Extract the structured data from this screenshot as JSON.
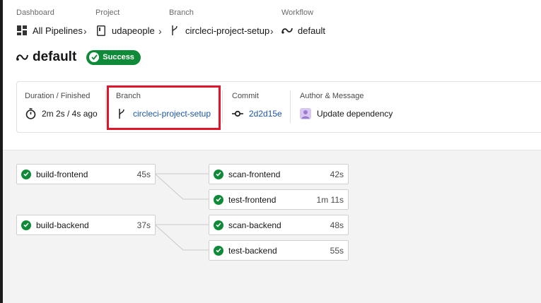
{
  "breadcrumbs": [
    {
      "label": "Dashboard",
      "value": "All Pipelines",
      "icon": "dashboard-icon"
    },
    {
      "label": "Project",
      "value": "udapeople",
      "icon": "project-icon"
    },
    {
      "label": "Branch",
      "value": "circleci-project-setup",
      "icon": "branch-icon"
    },
    {
      "label": "Workflow",
      "value": "default",
      "icon": "workflow-icon"
    }
  ],
  "title": "default",
  "status": {
    "label": "Success",
    "color": "#0f8a38"
  },
  "summary": {
    "duration": {
      "label": "Duration / Finished",
      "value": "2m 2s / 4s ago",
      "icon": "stopwatch-icon"
    },
    "branch": {
      "label": "Branch",
      "value": "circleci-project-setup",
      "icon": "branch-icon"
    },
    "commit": {
      "label": "Commit",
      "value": "2d2d15e",
      "icon": "commit-icon"
    },
    "author": {
      "label": "Author & Message",
      "value": "Update dependency",
      "icon": "avatar-icon"
    }
  },
  "jobs": [
    {
      "name": "build-frontend",
      "duration": "45s"
    },
    {
      "name": "scan-frontend",
      "duration": "42s"
    },
    {
      "name": "test-frontend",
      "duration": "1m 11s"
    },
    {
      "name": "build-backend",
      "duration": "37s"
    },
    {
      "name": "scan-backend",
      "duration": "48s"
    },
    {
      "name": "test-backend",
      "duration": "55s"
    }
  ],
  "colors": {
    "success": "#0f8a38",
    "link": "#1c55a8",
    "highlight": "#e0142a"
  }
}
